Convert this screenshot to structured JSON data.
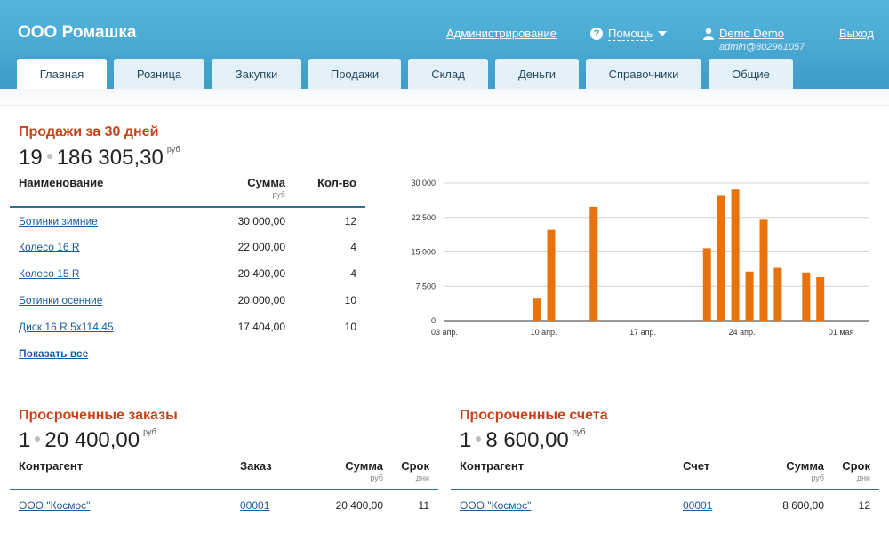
{
  "header": {
    "brand": "ООО Ромашка",
    "admin_link": "Администрирование",
    "help_label": "Помощь",
    "help_icon": "question-circle-icon",
    "user_name": "Demo Demo",
    "user_icon": "user-icon",
    "user_sub": "admin@802961057",
    "logout": "Выход",
    "colors": {
      "bar": "#45a9d4",
      "title": "#c6441b"
    }
  },
  "tabs": [
    {
      "label": "Главная",
      "active": true
    },
    {
      "label": "Розница"
    },
    {
      "label": "Закупки"
    },
    {
      "label": "Продажи"
    },
    {
      "label": "Склад"
    },
    {
      "label": "Деньги"
    },
    {
      "label": "Справочники"
    },
    {
      "label": "Общие"
    }
  ],
  "sales": {
    "title": "Продажи за 30 дней",
    "count": "19",
    "total": "186 305,30",
    "currency": "руб",
    "col_name": "Наименование",
    "col_sum": "Сумма",
    "col_sum_sub": "руб",
    "col_qty": "Кол-во",
    "rows": [
      {
        "name": "Ботинки зимние",
        "sum": "30 000,00",
        "qty": "12"
      },
      {
        "name": "Колесо 16 R",
        "sum": "22 000,00",
        "qty": "4"
      },
      {
        "name": "Колесо 15 R",
        "sum": "20 400,00",
        "qty": "4"
      },
      {
        "name": "Ботинки осенние",
        "sum": "20 000,00",
        "qty": "10"
      },
      {
        "name": "Диск 16 R 5x114 45",
        "sum": "17 404,00",
        "qty": "10"
      }
    ],
    "show_all": "Показать все"
  },
  "chart_data": {
    "type": "bar",
    "color": "#e8720e",
    "ylim": [
      0,
      30000
    ],
    "yticks": [
      0,
      7500,
      15000,
      22500,
      30000
    ],
    "ytick_labels": [
      "0",
      "7 500",
      "15 000",
      "22 500",
      "30 000"
    ],
    "xtick_labels": [
      "03 апр.",
      "10 апр.",
      "17 апр.",
      "24 апр.",
      "01 мая"
    ],
    "days": 30,
    "bars": [
      {
        "day": 6,
        "value": 4800
      },
      {
        "day": 7,
        "value": 19800
      },
      {
        "day": 10,
        "value": 24800
      },
      {
        "day": 18,
        "value": 15800
      },
      {
        "day": 19,
        "value": 27200
      },
      {
        "day": 20,
        "value": 28600
      },
      {
        "day": 21,
        "value": 10700
      },
      {
        "day": 22,
        "value": 22000
      },
      {
        "day": 23,
        "value": 11500
      },
      {
        "day": 25,
        "value": 10500
      },
      {
        "day": 26,
        "value": 9500
      }
    ]
  },
  "orders": {
    "title": "Просроченные заказы",
    "count": "1",
    "total": "20 400,00",
    "currency": "руб",
    "col_party": "Контрагент",
    "col_doc": "Заказ",
    "col_sum": "Сумма",
    "col_sum_sub": "руб",
    "col_term": "Срок",
    "col_term_sub": "дни",
    "row": {
      "party": "ООО \"Космос\"",
      "doc": "00001",
      "sum": "20 400,00",
      "term": "11"
    }
  },
  "invoices": {
    "title": "Просроченные счета",
    "count": "1",
    "total": "8 600,00",
    "currency": "руб",
    "col_party": "Контрагент",
    "col_doc": "Счет",
    "col_sum": "Сумма",
    "col_sum_sub": "руб",
    "col_term": "Срок",
    "col_term_sub": "дни",
    "row": {
      "party": "ООО \"Космос\"",
      "doc": "00001",
      "sum": "8 600,00",
      "term": "12"
    }
  }
}
